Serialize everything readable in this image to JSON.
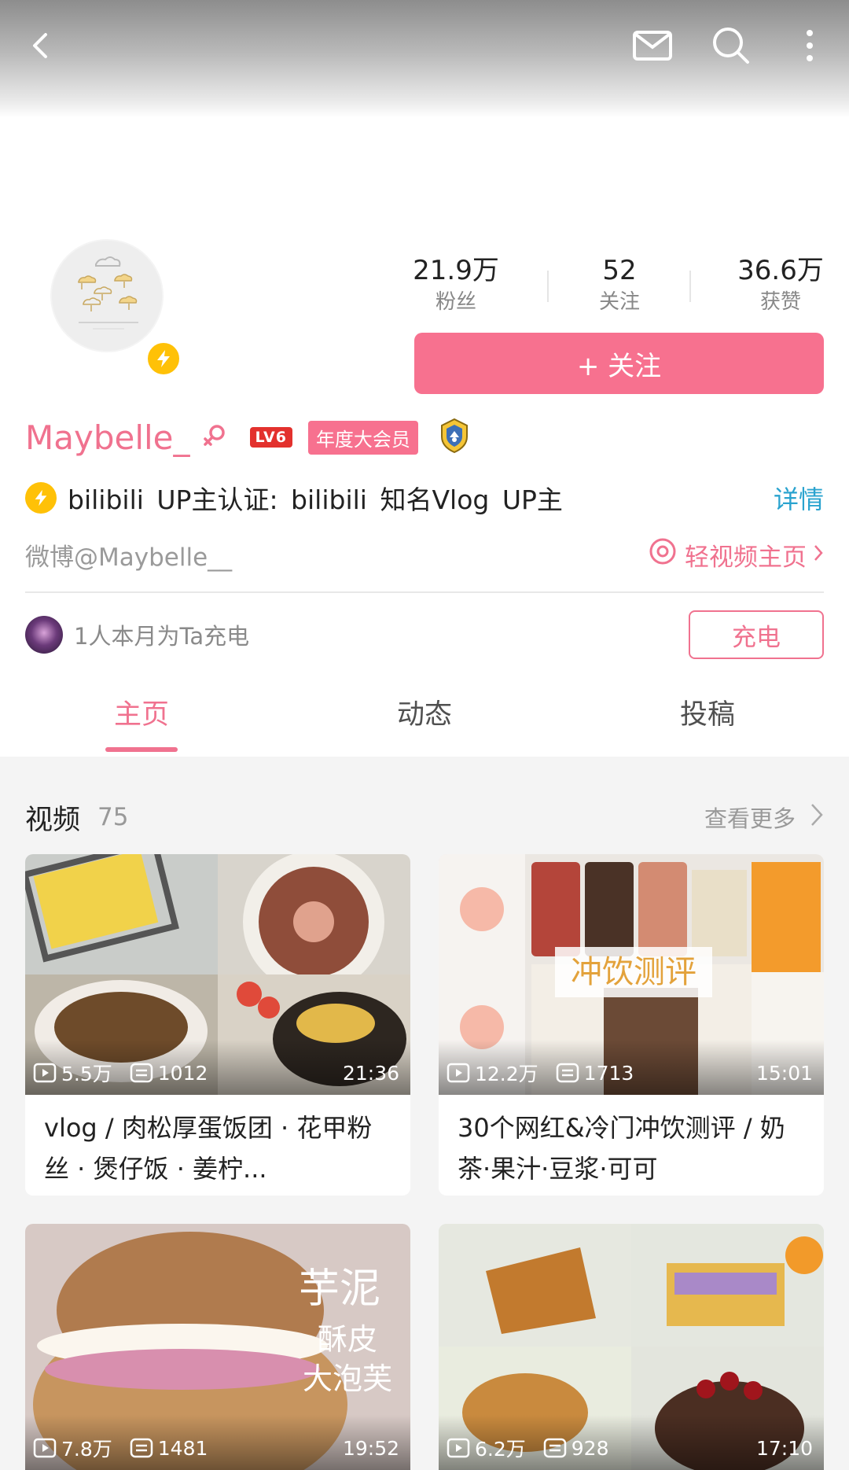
{
  "profile": {
    "name": "Maybelle_",
    "level": "LV6",
    "vip": "年度大会员",
    "certification": "bilibili  UP主认证: bilibili  知名Vlog  UP主",
    "details": "详情",
    "weibo": "微博@Maybelle__",
    "light_video": "轻视频主页"
  },
  "stats": {
    "fans_value": "21.9万",
    "fans_label": "粉丝",
    "following_value": "52",
    "following_label": "关注",
    "likes_value": "36.6万",
    "likes_label": "获赞"
  },
  "follow_button": "+ 关注",
  "charge": {
    "text": "1人本月为Ta充电",
    "button": "充电"
  },
  "tabs": [
    "主页",
    "动态",
    "投稿"
  ],
  "videos_section": {
    "title": "视频",
    "count": "75",
    "see_more": "查看更多"
  },
  "videos": [
    {
      "views": "5.5万",
      "danmaku": "1012",
      "duration": "21:36",
      "title": "vlog / 肉松厚蛋饭团 · 花甲粉丝 · 煲仔饭 · 姜柠..."
    },
    {
      "views": "12.2万",
      "danmaku": "1713",
      "duration": "15:01",
      "title": "30个网红&冷门冲饮测评 / 奶茶·果汁·豆浆·可可",
      "thumb_text": "冲饮测评"
    },
    {
      "views": "7.8万",
      "danmaku": "1481",
      "duration": "19:52",
      "thumb_text_1": "芋泥",
      "thumb_text_2": "酥皮",
      "thumb_text_3": "大泡芙"
    },
    {
      "views": "6.2万",
      "danmaku": "928",
      "duration": "17:10"
    }
  ],
  "colors": {
    "accent": "#f7718f",
    "link": "#2aa3cf",
    "bolt": "#ffc107"
  }
}
